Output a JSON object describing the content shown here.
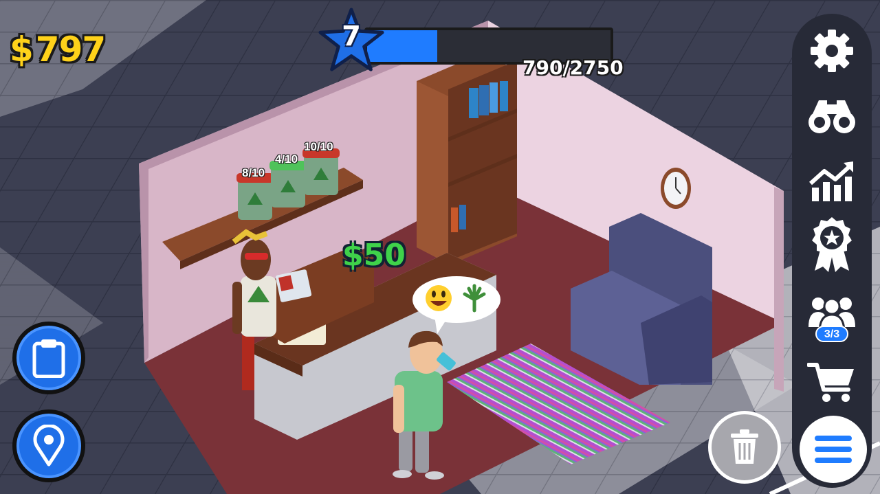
{
  "hud": {
    "money_symbol": "$",
    "money_value": "797",
    "level": "7",
    "xp_text": "790/2750",
    "xp_current": 790,
    "xp_max": 2750
  },
  "shop": {
    "price_symbol": "$",
    "price_value": "50",
    "jars": [
      {
        "label": "8/10",
        "lid_color": "#c8372a"
      },
      {
        "label": "4/10",
        "lid_color": "#4fc25a"
      },
      {
        "label": "10/10",
        "lid_color": "#c8372a"
      }
    ],
    "customer_bubble": [
      "grinning-face-emoji",
      "cannabis-leaf-icon"
    ]
  },
  "sidebar": {
    "items": [
      {
        "icon": "gear-icon"
      },
      {
        "icon": "binoculars-icon"
      },
      {
        "icon": "stats-chart-icon"
      },
      {
        "icon": "award-badge-icon"
      },
      {
        "icon": "group-icon",
        "badge": "3/3"
      },
      {
        "icon": "shopping-cart-icon"
      }
    ],
    "menu_icon": "hamburger-menu-icon"
  },
  "left_buttons": [
    {
      "icon": "clipboard-icon"
    },
    {
      "icon": "map-pin-icon"
    }
  ],
  "trash_icon": "trash-icon",
  "colors": {
    "accent_blue": "#1f7cff",
    "money_yellow": "#ffd21a",
    "price_green": "#3fd24a",
    "wall_pink": "#d9b9c9",
    "floor_maroon": "#7a3238",
    "sidebar_dark": "#272a37"
  }
}
